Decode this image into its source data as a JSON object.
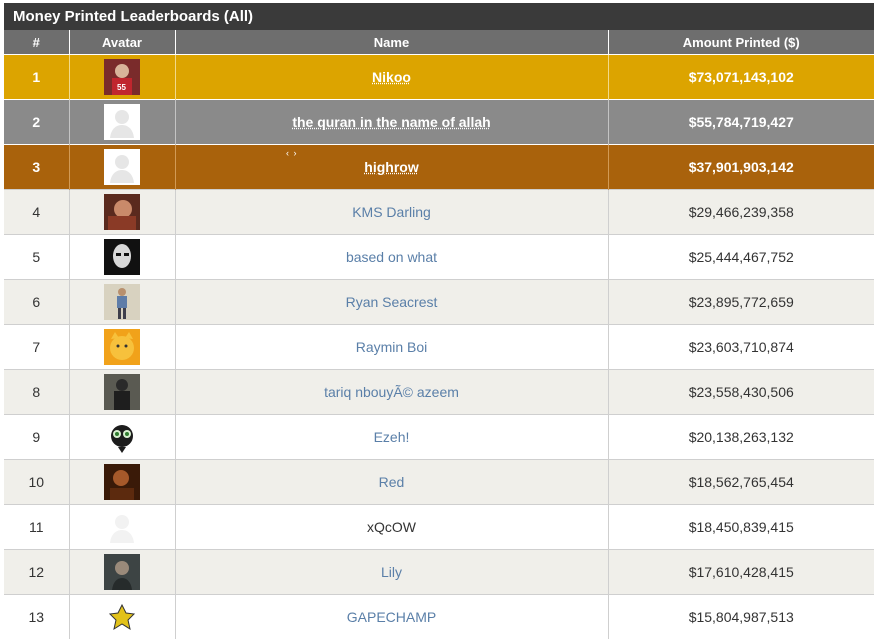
{
  "title": "Money Printed Leaderboards (All)",
  "columns": [
    "#",
    "Avatar",
    "Name",
    "Amount Printed ($)"
  ],
  "drag_hint": "‹ ›",
  "rows": [
    {
      "rank": "1",
      "name": "Nikoo",
      "amount": "$73,071,143,102",
      "avatar": "red-sports-avatar-icon",
      "tier": "gold",
      "link": true
    },
    {
      "rank": "2",
      "name": "the quran in the name of allah",
      "amount": "$55,784,719,427",
      "avatar": "default-avatar-icon",
      "tier": "silver",
      "link": true
    },
    {
      "rank": "3",
      "name": "highrow",
      "amount": "$37,901,903,142",
      "avatar": "default-avatar-icon",
      "tier": "bronze",
      "link": true
    },
    {
      "rank": "4",
      "name": "KMS Darling",
      "amount": "$29,466,239,358",
      "avatar": "portrait-avatar-icon",
      "tier": "even",
      "link": true
    },
    {
      "rank": "5",
      "name": "based on what",
      "amount": "$25,444,467,752",
      "avatar": "dark-face-avatar-icon",
      "tier": "odd",
      "link": true
    },
    {
      "rank": "6",
      "name": "Ryan Seacrest",
      "amount": "$23,895,772,659",
      "avatar": "standing-person-avatar-icon",
      "tier": "even",
      "link": true
    },
    {
      "rank": "7",
      "name": "Raymin Boi",
      "amount": "$23,603,710,874",
      "avatar": "yellow-cat-avatar-icon",
      "tier": "odd",
      "link": true
    },
    {
      "rank": "8",
      "name": "tariq nbouyÃ© azeem",
      "amount": "$23,558,430,506",
      "avatar": "dark-figure-avatar-icon",
      "tier": "even",
      "link": true
    },
    {
      "rank": "9",
      "name": "Ezeh!",
      "amount": "$20,138,263,132",
      "avatar": "cartoon-girl-avatar-icon",
      "tier": "odd",
      "link": true
    },
    {
      "rank": "10",
      "name": "Red",
      "amount": "$18,562,765,454",
      "avatar": "dark-brown-avatar-icon",
      "tier": "even",
      "link": true
    },
    {
      "rank": "11",
      "name": "xQcOW",
      "amount": "$18,450,839,415",
      "avatar": "default-avatar-faint-icon",
      "tier": "odd",
      "link": false
    },
    {
      "rank": "12",
      "name": "Lily",
      "amount": "$17,610,428,415",
      "avatar": "gray-portrait-avatar-icon",
      "tier": "even",
      "link": true
    },
    {
      "rank": "13",
      "name": "GAPECHAMP",
      "amount": "$15,804,987,513",
      "avatar": "yellow-sprite-avatar-icon",
      "tier": "odd",
      "link": true
    }
  ]
}
